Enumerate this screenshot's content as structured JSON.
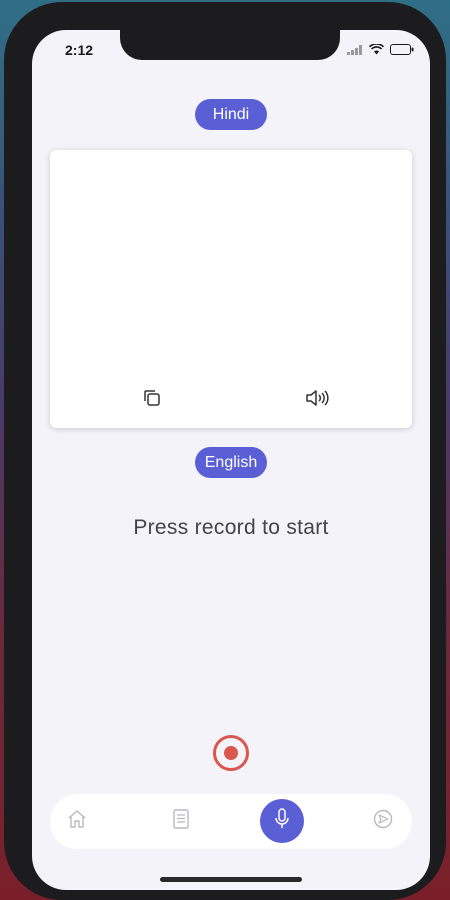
{
  "status_bar": {
    "time": "2:12",
    "icons": [
      "signal-icon",
      "wifi-icon",
      "battery-icon"
    ]
  },
  "source_language": {
    "label": "Hindi"
  },
  "target_language": {
    "label": "English"
  },
  "translation_card": {
    "text": "",
    "actions": [
      "copy-icon",
      "speaker-icon"
    ]
  },
  "prompt": {
    "text": "Press record to start"
  },
  "record_button": {
    "icon": "record-icon",
    "color": "#d9574e"
  },
  "tab_bar": {
    "tabs": [
      {
        "icon": "home-icon",
        "active": false
      },
      {
        "icon": "document-icon",
        "active": false
      },
      {
        "icon": "microphone-icon",
        "active": true
      },
      {
        "icon": "send-icon",
        "active": false
      }
    ]
  },
  "colors": {
    "accent": "#5b5fd6",
    "background": "#f3f3f9",
    "record": "#d9574e"
  }
}
